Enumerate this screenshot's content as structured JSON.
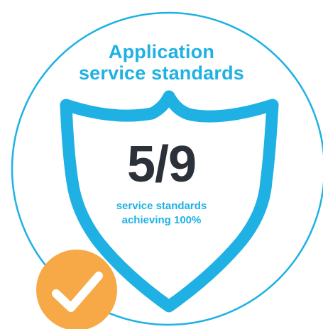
{
  "badge": {
    "title_line1": "Application",
    "title_line2": "service standards",
    "value": "5/9",
    "caption_line1": "service standards",
    "caption_line2": "achieving 100%",
    "shield_icon": "shield-icon",
    "check_icon": "checkmark-icon"
  },
  "colors": {
    "accent_blue": "#1fb1e3",
    "value_text": "#2b3138",
    "check_circle": "#f6a946",
    "background": "#ffffff"
  }
}
